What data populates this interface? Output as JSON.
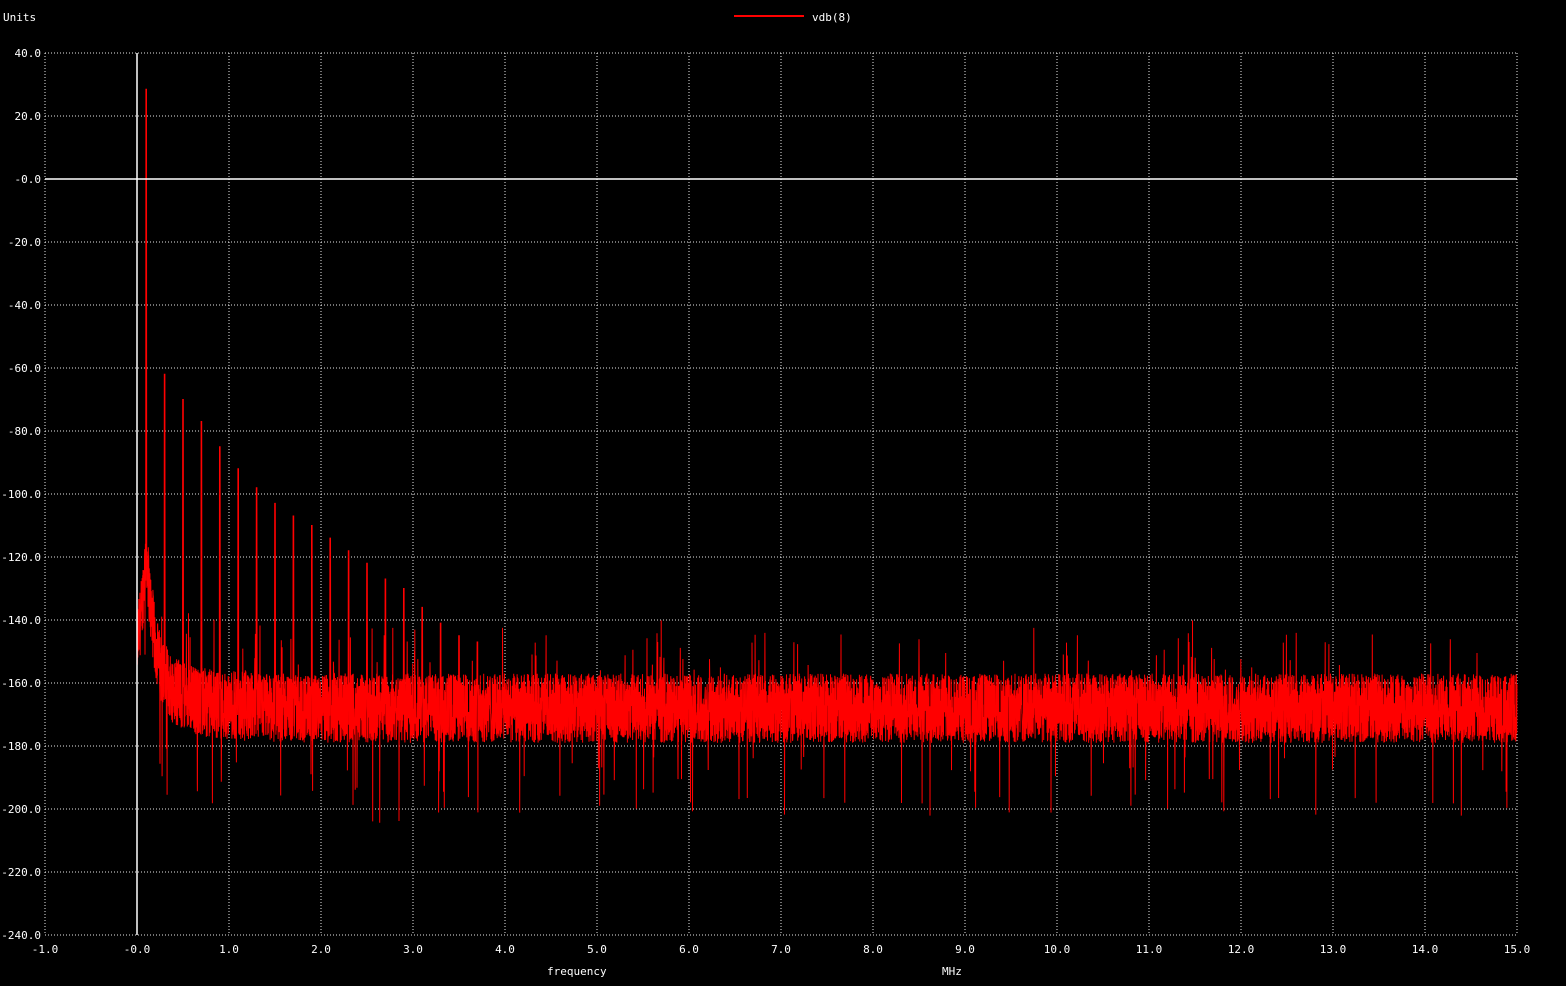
{
  "chart_data": {
    "type": "line",
    "ylabel": "Units",
    "xlabel": "frequency",
    "x_unit": "MHz",
    "xlim": [
      -1.0,
      15.0
    ],
    "ylim": [
      -240.0,
      40.0
    ],
    "x_ticks": [
      "-1.0",
      "-0.0",
      "1.0",
      "2.0",
      "3.0",
      "4.0",
      "5.0",
      "6.0",
      "7.0",
      "8.0",
      "9.0",
      "10.0",
      "11.0",
      "12.0",
      "13.0",
      "14.0",
      "15.0"
    ],
    "y_ticks": [
      "40.0",
      "20.0",
      "-0.0",
      "-20.0",
      "-40.0",
      "-60.0",
      "-80.0",
      "-100.0",
      "-120.0",
      "-140.0",
      "-160.0",
      "-180.0",
      "-200.0",
      "-220.0",
      "-240.0"
    ],
    "grid": true,
    "legend_position": "top-center",
    "series": [
      {
        "name": "vdb(8)",
        "color": "#ff0000",
        "peak": {
          "x": 0.1,
          "y": 28.5
        },
        "harmonic_spacing_mhz": 0.1,
        "harmonic_peaks": [
          [
            0.1,
            28.5
          ],
          [
            0.3,
            -62
          ],
          [
            0.5,
            -70
          ],
          [
            0.7,
            -77
          ],
          [
            0.9,
            -85
          ],
          [
            1.1,
            -92
          ],
          [
            1.3,
            -98
          ],
          [
            1.5,
            -103
          ],
          [
            1.7,
            -107
          ],
          [
            1.9,
            -110
          ],
          [
            2.1,
            -114
          ],
          [
            2.3,
            -118
          ],
          [
            2.5,
            -122
          ],
          [
            2.7,
            -127
          ],
          [
            2.9,
            -130
          ],
          [
            3.1,
            -136
          ],
          [
            3.3,
            -141
          ],
          [
            3.5,
            -145
          ],
          [
            3.7,
            -147
          ]
        ],
        "noise_floor_mean": -168,
        "noise_floor_min": -205,
        "noise_floor_max": -138
      }
    ]
  },
  "axes": {
    "x_axis_color": "#ffffff",
    "y_axis_color": "#ffffff"
  }
}
